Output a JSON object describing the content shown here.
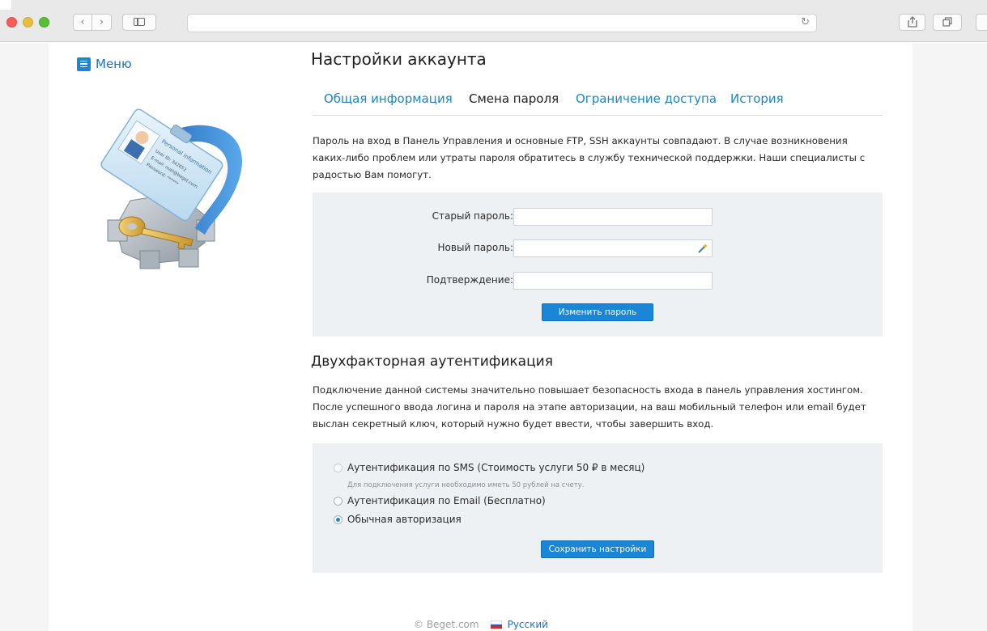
{
  "menu": {
    "label": "Меню"
  },
  "page": {
    "title": "Настройки аккаунта",
    "tabs": [
      {
        "label": "Общая информация",
        "active": false
      },
      {
        "label": "Смена пароля",
        "active": true
      },
      {
        "label": "Ограничение доступа",
        "active": false
      },
      {
        "label": "История",
        "active": false
      }
    ],
    "info_text": "Пароль на вход в Панель Управления и основные FTP, SSH аккаунты совпадают. В случае возникновения каких-либо проблем или утраты пароля обратитесь в службу технической поддержки. Наши специалисты с радостью Вам помогут."
  },
  "password_form": {
    "old_label": "Старый пароль:",
    "new_label": "Новый пароль:",
    "confirm_label": "Подтверждение:",
    "old_value": "",
    "new_value": "",
    "confirm_value": "",
    "submit_label": "Изменить пароль"
  },
  "two_factor": {
    "title": "Двухфакторная аутентификация",
    "description": "Подключение данной системы значительно повышает безопасность входа в панель управления хостингом. После успешного ввода логина и пароля на этапе авторизации, на ваш мобильный телефон или email будет выслан секретный ключ, который нужно будет ввести, чтобы завершить вход.",
    "options": [
      {
        "label": "Аутентификация по SMS (Стоимость услуги 50 ₽ в месяц)",
        "checked": false,
        "disabled": true
      },
      {
        "label": "Аутентификация по Email (Бесплатно)",
        "checked": false,
        "disabled": false
      },
      {
        "label": "Обычная авторизация",
        "checked": true,
        "disabled": false
      }
    ],
    "sms_note": "Для подключения услуги необходимо иметь 50 рублей на счету.",
    "save_label": "Сохранить настройки"
  },
  "illustration": {
    "card_title": "Personal information",
    "card_lines": [
      "User ID: 342652",
      "E-mail: mail@beget.com",
      "Password: ******"
    ]
  },
  "footer": {
    "copyright": "© Beget.com",
    "language": "Русский"
  },
  "colors": {
    "accent": "#1a86d8",
    "link": "#1a73c4",
    "panel": "#eef1f4"
  },
  "icons": {
    "reload": "reload-icon",
    "share": "share-icon",
    "tabs": "tabs-icon",
    "wand": "magic-wand-icon"
  }
}
